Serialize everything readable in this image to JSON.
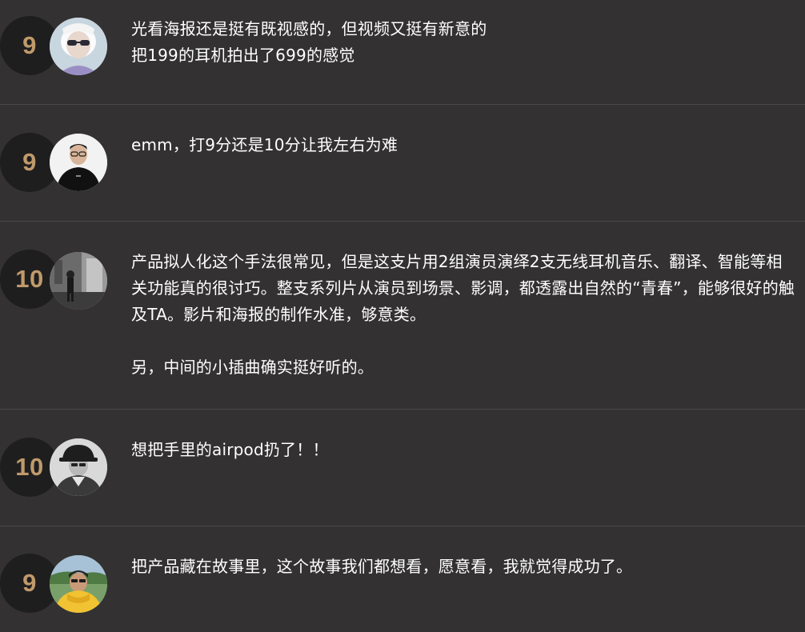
{
  "reviews": [
    {
      "score": "9",
      "avatar_icon": "user-avatar-sunglasses-icon",
      "text": "光看海报还是挺有既视感的，但视频又挺有新意的\n把199的耳机拍出了699的感觉"
    },
    {
      "score": "9",
      "avatar_icon": "user-avatar-black-tshirt-icon",
      "text": "emm，打9分还是10分让我左右为难"
    },
    {
      "score": "10",
      "avatar_icon": "user-avatar-street-photo-icon",
      "text": "产品拟人化这个手法很常见，但是这支片用2组演员演绎2支无线耳机音乐、翻译、智能等相关功能真的很讨巧。整支系列片从演员到场景、影调，都透露出自然的“青春”，能够很好的触及TA。影片和海报的制作水准，够意类。\n\n另，中间的小插曲确实挺好听的。"
    },
    {
      "score": "10",
      "avatar_icon": "user-avatar-bucket-hat-icon",
      "text": "想把手里的airpod扔了！！"
    },
    {
      "score": "9",
      "avatar_icon": "user-avatar-yellow-hoodie-icon",
      "text": "把产品藏在故事里，这个故事我们都想看，愿意看，我就觉得成功了。"
    }
  ],
  "colors": {
    "background": "#333132",
    "score_text": "#c09a6b",
    "score_circle": "#1f1e1f",
    "divider": "#4a4849"
  }
}
